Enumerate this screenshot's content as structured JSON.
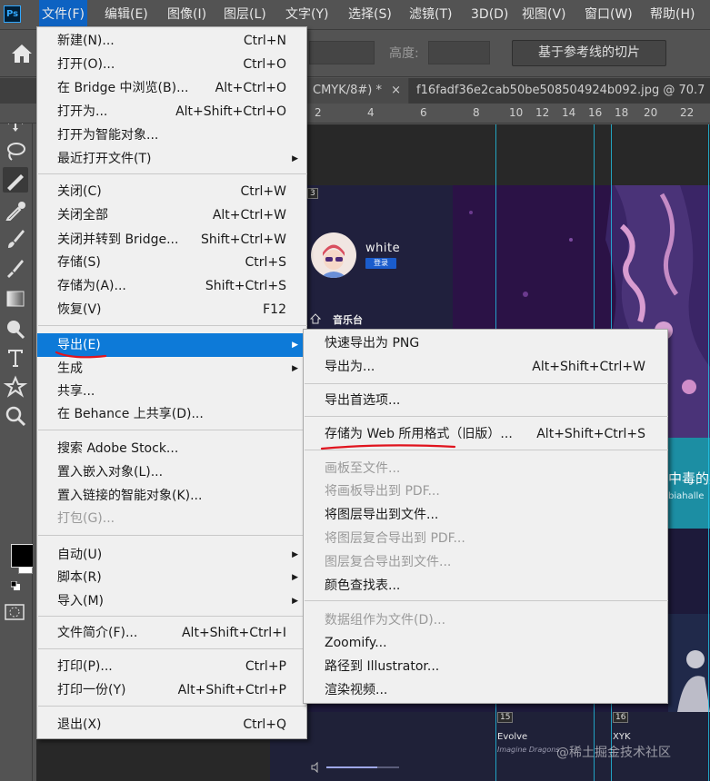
{
  "app": {
    "logo": "Ps"
  },
  "menubar": {
    "items": [
      {
        "label": "文件(F)"
      },
      {
        "label": "编辑(E)"
      },
      {
        "label": "图像(I)"
      },
      {
        "label": "图层(L)"
      },
      {
        "label": "文字(Y)"
      },
      {
        "label": "选择(S)"
      },
      {
        "label": "滤镜(T)"
      },
      {
        "label": "3D(D)"
      },
      {
        "label": "视图(V)"
      },
      {
        "label": "窗口(W)"
      },
      {
        "label": "帮助(H)"
      }
    ]
  },
  "options_bar": {
    "height_label": "高度:",
    "slice_button": "基于参考线的切片"
  },
  "tabs": [
    {
      "label": "CMYK/8#) *",
      "close": "×"
    },
    {
      "label": "f16fadf36e2cab50be508504924b092.jpg @ 70.7"
    }
  ],
  "ruler": {
    "labels": [
      "2",
      "4",
      "6",
      "8",
      "10",
      "12",
      "14",
      "16",
      "18",
      "20",
      "22"
    ]
  },
  "file_menu": {
    "items": [
      {
        "label": "新建(N)...",
        "shortcut": "Ctrl+N"
      },
      {
        "label": "打开(O)...",
        "shortcut": "Ctrl+O"
      },
      {
        "label": "在 Bridge 中浏览(B)...",
        "shortcut": "Alt+Ctrl+O"
      },
      {
        "label": "打开为...",
        "shortcut": "Alt+Shift+Ctrl+O"
      },
      {
        "label": "打开为智能对象...",
        "shortcut": ""
      },
      {
        "label": "最近打开文件(T)",
        "shortcut": "",
        "submenu": true
      },
      {
        "label": "关闭(C)",
        "shortcut": "Ctrl+W"
      },
      {
        "label": "关闭全部",
        "shortcut": "Alt+Ctrl+W"
      },
      {
        "label": "关闭并转到 Bridge...",
        "shortcut": "Shift+Ctrl+W"
      },
      {
        "label": "存储(S)",
        "shortcut": "Ctrl+S"
      },
      {
        "label": "存储为(A)...",
        "shortcut": "Shift+Ctrl+S"
      },
      {
        "label": "恢复(V)",
        "shortcut": "F12"
      },
      {
        "label": "导出(E)",
        "shortcut": "",
        "submenu": true,
        "highlight": true
      },
      {
        "label": "生成",
        "shortcut": "",
        "submenu": true
      },
      {
        "label": "共享...",
        "shortcut": ""
      },
      {
        "label": "在 Behance 上共享(D)...",
        "shortcut": ""
      },
      {
        "label": "搜索 Adobe Stock...",
        "shortcut": ""
      },
      {
        "label": "置入嵌入对象(L)...",
        "shortcut": ""
      },
      {
        "label": "置入链接的智能对象(K)...",
        "shortcut": ""
      },
      {
        "label": "打包(G)...",
        "shortcut": "",
        "disabled": true
      },
      {
        "label": "自动(U)",
        "shortcut": "",
        "submenu": true
      },
      {
        "label": "脚本(R)",
        "shortcut": "",
        "submenu": true
      },
      {
        "label": "导入(M)",
        "shortcut": "",
        "submenu": true
      },
      {
        "label": "文件简介(F)...",
        "shortcut": "Alt+Shift+Ctrl+I"
      },
      {
        "label": "打印(P)...",
        "shortcut": "Ctrl+P"
      },
      {
        "label": "打印一份(Y)",
        "shortcut": "Alt+Shift+Ctrl+P"
      },
      {
        "label": "退出(X)",
        "shortcut": "Ctrl+Q"
      }
    ]
  },
  "export_submenu": {
    "items": [
      {
        "label": "快速导出为 PNG",
        "shortcut": ""
      },
      {
        "label": "导出为...",
        "shortcut": "Alt+Shift+Ctrl+W"
      },
      {
        "label": "导出首选项...",
        "shortcut": ""
      },
      {
        "label": "存储为 Web 所用格式（旧版）...",
        "shortcut": "Alt+Shift+Ctrl+S"
      },
      {
        "label": "画板至文件...",
        "shortcut": "",
        "disabled": true
      },
      {
        "label": "将画板导出到 PDF...",
        "shortcut": "",
        "disabled": true
      },
      {
        "label": "将图层导出到文件...",
        "shortcut": ""
      },
      {
        "label": "将图层复合导出到 PDF...",
        "shortcut": "",
        "disabled": true
      },
      {
        "label": "图层复合导出到文件...",
        "shortcut": "",
        "disabled": true
      },
      {
        "label": "颜色查找表...",
        "shortcut": ""
      },
      {
        "label": "数据组作为文件(D)...",
        "shortcut": "",
        "disabled": true
      },
      {
        "label": "Zoomify...",
        "shortcut": ""
      },
      {
        "label": "路径到 Illustrator...",
        "shortcut": ""
      },
      {
        "label": "渲染视频...",
        "shortcut": ""
      }
    ]
  },
  "canvas": {
    "user_name": "white",
    "user_badge": "登录",
    "nav_label": "音乐台",
    "banner_title": "中毒的英",
    "banner_sub": "biahalle",
    "album_1_title": "Evolve",
    "album_1_sub": "Imagine Dragons",
    "album_2_title": "XYK",
    "slice_tags": [
      "3",
      "15",
      "16"
    ],
    "watermark": "@稀土掘金技术社区",
    "volume_level": 0.7
  },
  "colors": {
    "menu_highlight": "#0d7ad8",
    "menubar_active": "#0d62c2",
    "annotation_red": "#e0141e"
  }
}
